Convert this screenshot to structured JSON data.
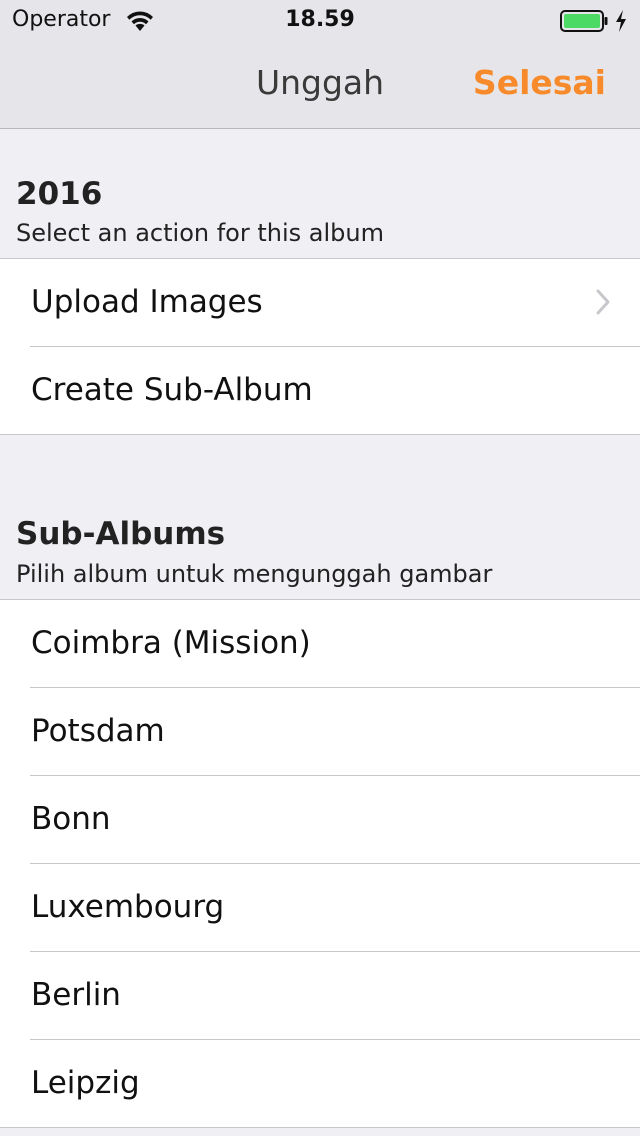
{
  "status_bar": {
    "carrier": "Operator",
    "time": "18.59",
    "wifi_icon": "wifi-icon",
    "battery_icon": "battery-icon",
    "charging_icon": "charging-bolt-icon",
    "battery_color": "#4cd964"
  },
  "nav": {
    "title": "Unggah",
    "done_label": "Selesai",
    "accent_color": "#f78a2a"
  },
  "album_section": {
    "title": "2016",
    "subtitle": "Select an action for this album",
    "actions": [
      {
        "label": "Upload Images",
        "icon": "chevron-right-icon"
      },
      {
        "label": "Create Sub-Album"
      }
    ]
  },
  "sub_albums_section": {
    "title": "Sub-Albums",
    "subtitle": "Pilih album untuk mengunggah gambar",
    "items": [
      {
        "label": "Coimbra (Mission)"
      },
      {
        "label": "Potsdam"
      },
      {
        "label": "Bonn"
      },
      {
        "label": "Luxembourg"
      },
      {
        "label": "Berlin"
      },
      {
        "label": "Leipzig"
      }
    ]
  }
}
